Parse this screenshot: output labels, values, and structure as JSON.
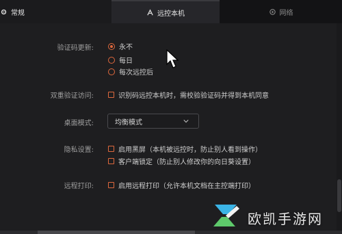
{
  "tabs": [
    {
      "label": "常规",
      "icon": "gear-icon"
    },
    {
      "label": "远控本机",
      "icon": "remote-icon"
    },
    {
      "label": "网络",
      "icon": "network-icon"
    }
  ],
  "settings": {
    "verify_code_update": {
      "label": "验证码更新:",
      "options": [
        "永不",
        "每日",
        "每次远控后"
      ],
      "selected": "永不"
    },
    "two_factor": {
      "label": "双重验证访问:",
      "option": "识别码远控本机时，需校验验证码并得到本机同意"
    },
    "desktop_mode": {
      "label": "桌面模式:",
      "value": "均衡模式"
    },
    "privacy": {
      "label": "隐私设置:",
      "options": [
        "启用黑屏（本机被远控时，防止别人看到操作）",
        "客户端锁定（防止别人修改你的向日葵设置）"
      ]
    },
    "remote_print": {
      "label": "远程打印:",
      "option": "启用远程打印（允许本机文档在主控端打印）"
    }
  },
  "watermark": {
    "text": "欧凯手游网"
  },
  "colors": {
    "accent": "#e0693d",
    "background": "#1e1e20"
  }
}
